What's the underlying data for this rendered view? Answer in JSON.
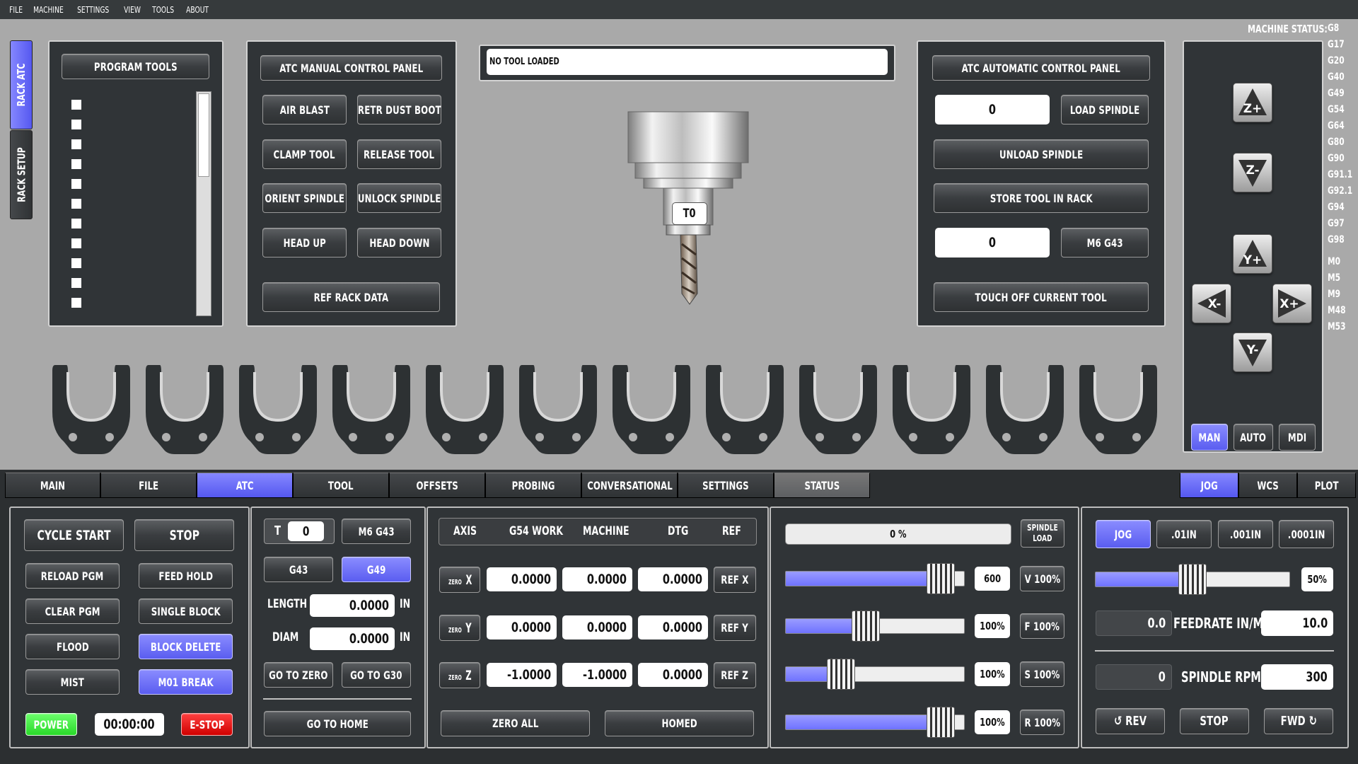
{
  "menu": [
    "FILE",
    "MACHINE",
    "SETTINGS",
    "VIEW",
    "TOOLS",
    "ABOUT"
  ],
  "side_tabs": {
    "rack_atc": "RACK ATC",
    "rack_setup": "RACK SETUP"
  },
  "program_tools": {
    "title": "PROGRAM TOOLS",
    "slots": 11
  },
  "atc_manual": {
    "title": "ATC MANUAL CONTROL PANEL",
    "air_blast": "AIR BLAST",
    "retr_dust_boot": "RETR DUST BOOT",
    "clamp_tool": "CLAMP TOOL",
    "release_tool": "RELEASE TOOL",
    "orient_spindle": "ORIENT SPINDLE",
    "unlock_spindle": "UNLOCK SPINDLE",
    "head_up": "HEAD UP",
    "head_down": "HEAD DOWN",
    "ref_rack_data": "REF RACK DATA"
  },
  "tool_status": "NO TOOL LOADED",
  "spindle_tool_label": "T0",
  "atc_auto": {
    "title": "ATC AUTOMATIC CONTROL PANEL",
    "load_value": "0",
    "load_spindle": "LOAD SPINDLE",
    "unload_spindle": "UNLOAD SPINDLE",
    "store_tool": "STORE TOOL IN RACK",
    "m6_value": "0",
    "m6_g43": "M6 G43",
    "touch_off": "TOUCH OFF CURRENT TOOL"
  },
  "machine_status": {
    "label": "MACHINE STATUS:",
    "codes": [
      "G8",
      "G17",
      "G20",
      "G40",
      "G49",
      "G54",
      "G64",
      "G80",
      "G90",
      "G91.1",
      "G92.1",
      "G94",
      "G97",
      "G98",
      "M0",
      "M5",
      "M9",
      "M48",
      "M53"
    ]
  },
  "jog_pad": {
    "z_plus": "Z+",
    "z_minus": "Z-",
    "y_plus": "Y+",
    "y_minus": "Y-",
    "x_minus": "X-",
    "x_plus": "X+"
  },
  "mode_buttons": {
    "man": "MAN",
    "auto": "AUTO",
    "mdi": "MDI"
  },
  "rack_holders": 12,
  "main_tabs": [
    "MAIN",
    "FILE",
    "ATC",
    "TOOL",
    "OFFSETS",
    "PROBING",
    "CONVERSATIONAL",
    "SETTINGS",
    "STATUS"
  ],
  "right_tabs": [
    "JOG",
    "WCS",
    "PLOT"
  ],
  "program": {
    "cycle_start": "CYCLE START",
    "stop": "STOP",
    "reload_pgm": "RELOAD PGM",
    "feed_hold": "FEED HOLD",
    "clear_pgm": "CLEAR PGM",
    "single_block": "SINGLE BLOCK",
    "flood": "FLOOD",
    "block_delete": "BLOCK DELETE",
    "mist": "MIST",
    "m01_break": "M01 BREAK",
    "power": "POWER",
    "timer": "00:00:00",
    "estop": "E-STOP"
  },
  "tool_panel": {
    "t_label": "T",
    "t_value": "0",
    "m6_g43": "M6 G43",
    "g43": "G43",
    "g49": "G49",
    "length_label": "LENGTH",
    "length_value": "0.0000",
    "length_unit": "IN",
    "diam_label": "DIAM",
    "diam_value": "0.0000",
    "diam_unit": "IN",
    "go_to_zero": "GO TO ZERO",
    "go_to_g30": "GO TO G30",
    "go_to_home": "GO TO HOME"
  },
  "dro": {
    "headers": [
      "AXIS",
      "G54 WORK",
      "MACHINE",
      "DTG",
      "REF"
    ],
    "rows": [
      {
        "zero": "ZERO",
        "axis": "X",
        "work": "0.0000",
        "machine": "0.0000",
        "dtg": "0.0000",
        "ref": "REF X"
      },
      {
        "zero": "ZERO",
        "axis": "Y",
        "work": "0.0000",
        "machine": "0.0000",
        "dtg": "0.0000",
        "ref": "REF Y"
      },
      {
        "zero": "ZERO",
        "axis": "Z",
        "work": "-1.0000",
        "machine": "-1.0000",
        "dtg": "0.0000",
        "ref": "REF Z"
      }
    ],
    "zero_all": "ZERO ALL",
    "homed": "HOMED"
  },
  "overrides": {
    "spindle_load": "0 %",
    "spindle_load_label": "SPINDLE LOAD",
    "rows": [
      {
        "value": "600",
        "button": "V 100%",
        "fraction": 0.87
      },
      {
        "value": "100%",
        "button": "F 100%",
        "fraction": 0.45
      },
      {
        "value": "100%",
        "button": "S 100%",
        "fraction": 0.31
      },
      {
        "value": "100%",
        "button": "R 100%",
        "fraction": 0.87
      }
    ]
  },
  "jog_panel": {
    "jog": "JOG",
    "inc1": ".01IN",
    "inc2": ".001IN",
    "inc3": ".0001IN",
    "jog_rate": "50%",
    "jog_fraction": 0.5,
    "feed_actual": "0.0",
    "feed_label": "FEEDRATE IN/M",
    "feed_set": "10.0",
    "rpm_actual": "0",
    "rpm_label": "SPINDLE RPM",
    "rpm_set": "300",
    "rev": "↺ REV",
    "stop": "STOP",
    "fwd": "FWD ↻"
  }
}
